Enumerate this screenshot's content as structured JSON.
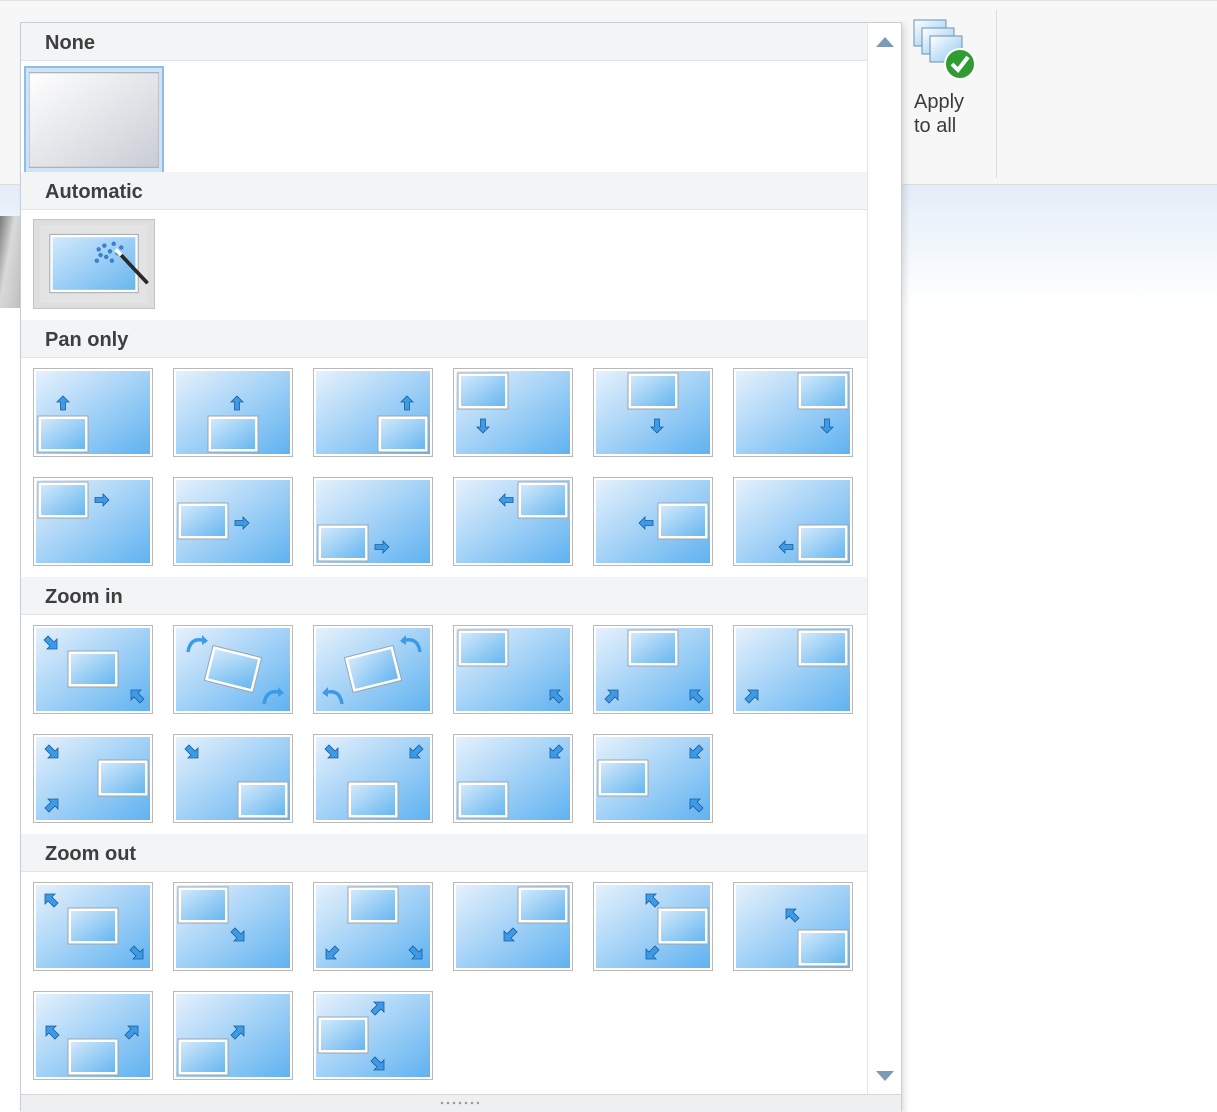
{
  "ribbon": {
    "apply_to_all_label": "Apply\nto all",
    "apply_icon": "apply-to-all-icon"
  },
  "gallery": {
    "sections": [
      {
        "label": "None",
        "items": [
          {
            "name": "none",
            "selected": true
          }
        ]
      },
      {
        "label": "Automatic",
        "items": [
          {
            "name": "automatic"
          }
        ]
      },
      {
        "label": "Pan only",
        "items": [
          {
            "name": "pan-up-bottom-left"
          },
          {
            "name": "pan-up-bottom-center"
          },
          {
            "name": "pan-up-bottom-right"
          },
          {
            "name": "pan-down-top-left"
          },
          {
            "name": "pan-down-top-center"
          },
          {
            "name": "pan-down-top-right"
          },
          {
            "name": "pan-right-top-left"
          },
          {
            "name": "pan-right-middle-left"
          },
          {
            "name": "pan-right-bottom-left"
          },
          {
            "name": "pan-left-top-right"
          },
          {
            "name": "pan-left-middle-right"
          },
          {
            "name": "pan-left-bottom-right"
          }
        ]
      },
      {
        "label": "Zoom in",
        "items": [
          {
            "name": "zoom-in-center"
          },
          {
            "name": "zoom-in-rotate-right"
          },
          {
            "name": "zoom-in-rotate-left"
          },
          {
            "name": "zoom-in-top-left"
          },
          {
            "name": "zoom-in-top-center"
          },
          {
            "name": "zoom-in-top-right"
          },
          {
            "name": "zoom-in-middle-right"
          },
          {
            "name": "zoom-in-bottom-right"
          },
          {
            "name": "zoom-in-bottom-center"
          },
          {
            "name": "zoom-in-bottom-left"
          },
          {
            "name": "zoom-in-middle-left"
          }
        ]
      },
      {
        "label": "Zoom out",
        "items": [
          {
            "name": "zoom-out-center"
          },
          {
            "name": "zoom-out-top-left"
          },
          {
            "name": "zoom-out-top-center"
          },
          {
            "name": "zoom-out-top-right"
          },
          {
            "name": "zoom-out-middle-right"
          },
          {
            "name": "zoom-out-bottom-right"
          },
          {
            "name": "zoom-out-bottom-center"
          },
          {
            "name": "zoom-out-bottom-left"
          },
          {
            "name": "zoom-out-middle-left"
          }
        ]
      }
    ]
  },
  "colors": {
    "thumb_light": "#e6f1fc",
    "thumb_dark": "#5fb2f1",
    "arrow": "#3d9ae6",
    "header_bg": "#f3f4f6",
    "selected_border": "#8fbde8"
  }
}
